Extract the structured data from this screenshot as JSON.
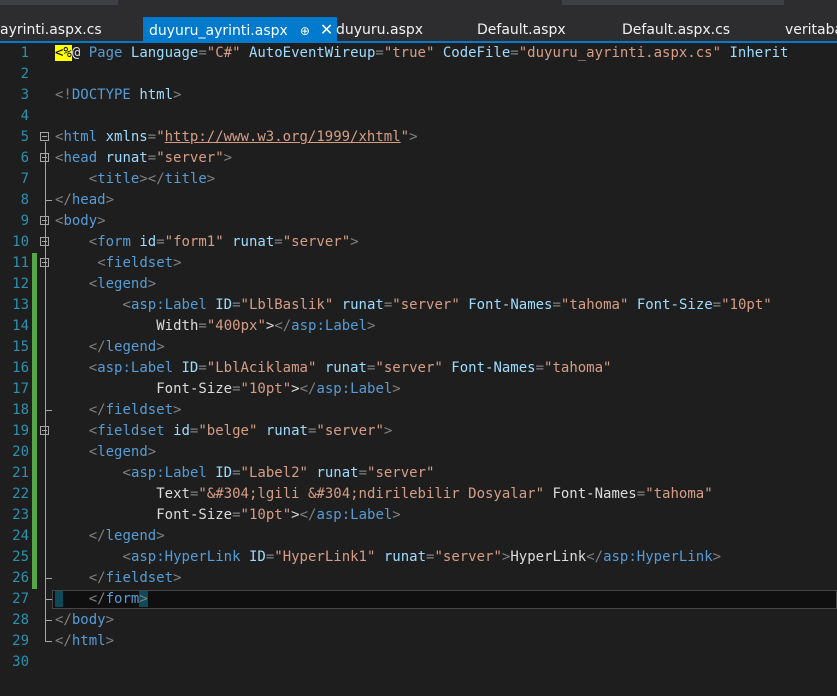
{
  "tabs": [
    {
      "label": "ayrinti.aspx.cs",
      "active": false
    },
    {
      "label": "duyuru_ayrinti.aspx",
      "active": true,
      "pin": "⊕",
      "close": "✕"
    },
    {
      "label": "duyuru.aspx",
      "active": false
    },
    {
      "label": "Default.aspx",
      "active": false
    },
    {
      "label": "Default.aspx.cs",
      "active": false
    },
    {
      "label": "veritaba",
      "active": false
    }
  ],
  "editor": {
    "current_line": 27,
    "lines": [
      {
        "n": "1",
        "t": "<%@ Page Language=\"C#\" AutoEventWireup=\"true\" CodeFile=\"duyuru_ayrinti.aspx.cs\" Inherit"
      },
      {
        "n": "2",
        "t": ""
      },
      {
        "n": "3",
        "t": "<!DOCTYPE html>"
      },
      {
        "n": "4",
        "t": ""
      },
      {
        "n": "5",
        "t": "<html xmlns=\"http://www.w3.org/1999/xhtml\">"
      },
      {
        "n": "6",
        "t": "<head runat=\"server\">"
      },
      {
        "n": "7",
        "t": "    <title></title>"
      },
      {
        "n": "8",
        "t": "</head>"
      },
      {
        "n": "9",
        "t": "<body>"
      },
      {
        "n": "10",
        "t": "    <form id=\"form1\" runat=\"server\">"
      },
      {
        "n": "11",
        "t": "     <fieldset>"
      },
      {
        "n": "12",
        "t": "    <legend>"
      },
      {
        "n": "13",
        "t": "        <asp:Label ID=\"LblBaslik\" runat=\"server\" Font-Names=\"tahoma\" Font-Size=\"10pt\""
      },
      {
        "n": "14",
        "t": "            Width=\"400px\"></asp:Label>"
      },
      {
        "n": "15",
        "t": "    </legend>"
      },
      {
        "n": "16",
        "t": "    <asp:Label ID=\"LblAciklama\" runat=\"server\" Font-Names=\"tahoma\""
      },
      {
        "n": "17",
        "t": "            Font-Size=\"10pt\"></asp:Label>"
      },
      {
        "n": "18",
        "t": "    </fieldset>"
      },
      {
        "n": "19",
        "t": "    <fieldset id=\"belge\" runat=\"server\">"
      },
      {
        "n": "20",
        "t": "    <legend>"
      },
      {
        "n": "21",
        "t": "        <asp:Label ID=\"Label2\" runat=\"server\""
      },
      {
        "n": "22",
        "t": "            Text=\"&#304;lgili &#304;ndirilebilir Dosyalar\" Font-Names=\"tahoma\""
      },
      {
        "n": "23",
        "t": "            Font-Size=\"10pt\"></asp:Label>"
      },
      {
        "n": "24",
        "t": "    </legend>"
      },
      {
        "n": "25",
        "t": "        <asp:HyperLink ID=\"HyperLink1\" runat=\"server\">HyperLink</asp:HyperLink>"
      },
      {
        "n": "26",
        "t": "    </fieldset>"
      },
      {
        "n": "27",
        "t": "    </form>"
      },
      {
        "n": "28",
        "t": "</body>"
      },
      {
        "n": "29",
        "t": "</html>"
      },
      {
        "n": "30",
        "t": ""
      }
    ]
  },
  "colors": {
    "background": "#1e1e1e",
    "tab_active": "#007acc",
    "line_number": "#2b91af",
    "tag": "#569cd6",
    "attribute": "#9cdcfe",
    "string": "#d69d85",
    "punctuation": "#808080",
    "change_marker": "#57a64a"
  }
}
